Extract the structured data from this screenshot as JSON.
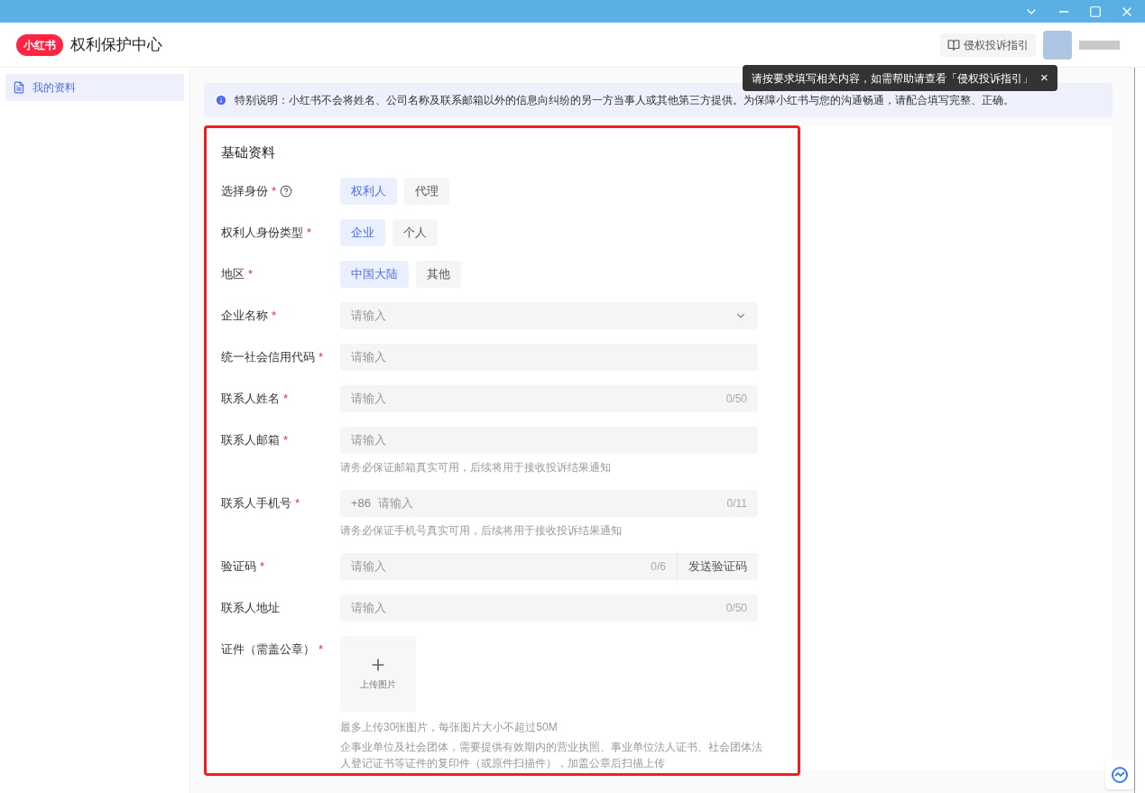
{
  "header": {
    "logo": "小红书",
    "title": "权利保护中心",
    "guide_button": "侵权投诉指引"
  },
  "tooltip": {
    "text": "请按要求填写相关内容，如需帮助请查看「侵权投诉指引」",
    "close": "×"
  },
  "sidebar": {
    "items": [
      {
        "label": "我的资料",
        "selected": true
      }
    ]
  },
  "notice": "特别说明：小红书不会将姓名、公司名称及联系邮箱以外的信息向纠纷的另一方当事人或其他第三方提供。为保障小红书与您的沟通畅通，请配合填写完整、正确。",
  "form": {
    "title": "基础资料",
    "rows": [
      {
        "kind": "choice",
        "label": "选择身份",
        "mark": "*",
        "help": true,
        "options": [
          {
            "label": "权利人",
            "selected": true
          },
          {
            "label": "代理",
            "selected": false
          }
        ]
      },
      {
        "kind": "choice",
        "label": "权利人身份类型",
        "mark": "*",
        "options": [
          {
            "label": "企业",
            "selected": true
          },
          {
            "label": "个人",
            "selected": false
          }
        ]
      },
      {
        "kind": "choice",
        "label": "地区",
        "mark": "*",
        "options": [
          {
            "label": "中国大陆",
            "selected": true
          },
          {
            "label": "其他",
            "selected": false
          }
        ]
      },
      {
        "kind": "select",
        "label": "企业名称",
        "mark": "*",
        "placeholder": "请输入"
      },
      {
        "kind": "input",
        "label": "统一社会信用代码",
        "mark": "*",
        "placeholder": "请输入"
      },
      {
        "kind": "input",
        "label": "联系人姓名",
        "mark": "*",
        "placeholder": "请输入",
        "counter": "0/50"
      },
      {
        "kind": "input",
        "label": "联系人邮箱",
        "mark": "*",
        "placeholder": "请输入",
        "hint": [
          "请务必保证邮箱真实可用，后续将用于接收投诉结果通知"
        ]
      },
      {
        "kind": "input",
        "label": "联系人手机号",
        "mark": "*",
        "prefix": "+86",
        "placeholder": "请输入",
        "counter": "0/11",
        "hint": [
          "请务必保证手机号真实可用，后续将用于接收投诉结果通知"
        ]
      },
      {
        "kind": "input",
        "label": "验证码",
        "mark": "*",
        "placeholder": "请输入",
        "counter": "0/6",
        "action": "发送验证码"
      },
      {
        "kind": "input",
        "label": "联系人地址",
        "placeholder": "请输入",
        "counter": "0/50"
      },
      {
        "kind": "upload",
        "label": "证件（需盖公章）",
        "mark": "*",
        "button": "上传图片",
        "hint": [
          "最多上传30张图片，每张图片大小不超过50M",
          "企事业单位及社会团体，需要提供有效期内的营业执照、事业单位法人证书、社会团体法人登记证书等证件的复印件（或原件扫描件），加盖公章后扫描上传"
        ]
      }
    ]
  }
}
